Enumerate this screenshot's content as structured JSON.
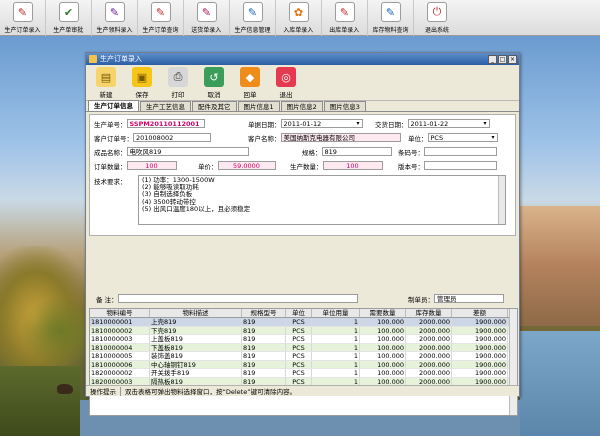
{
  "launcher": [
    {
      "label": "生产订单录入",
      "icon": "form-icon",
      "glyph": "✎",
      "color": "#c62828"
    },
    {
      "label": "生产单审批",
      "icon": "approve-icon",
      "glyph": "✔",
      "color": "#2e7d32"
    },
    {
      "label": "生产领料录入",
      "icon": "material-icon",
      "glyph": "✎",
      "color": "#6a1b9a"
    },
    {
      "label": "生产订单查询",
      "icon": "query-icon",
      "glyph": "✎",
      "color": "#c62828"
    },
    {
      "label": "送货单录入",
      "icon": "delivery-icon",
      "glyph": "✎",
      "color": "#ad1457"
    },
    {
      "label": "生产信息管理",
      "icon": "info-icon",
      "glyph": "✎",
      "color": "#1565c0"
    },
    {
      "label": "入库单录入",
      "icon": "stock-in-icon",
      "glyph": "✿",
      "color": "#ef6c00"
    },
    {
      "label": "出库单录入",
      "icon": "stock-out-icon",
      "glyph": "✎",
      "color": "#c62828"
    },
    {
      "label": "库存物料查询",
      "icon": "inventory-icon",
      "glyph": "✎",
      "color": "#1565c0"
    },
    {
      "label": "退出系统",
      "icon": "exit-icon",
      "glyph": "⏻",
      "color": "#c62828"
    }
  ],
  "window": {
    "title": "生产订单录入",
    "controls": [
      "_",
      "□",
      "×"
    ]
  },
  "toolbar": [
    {
      "label": "新建",
      "icon": "new-doc-icon",
      "glyph": "▤",
      "bg": "#f7d46b",
      "fg": "#7a5a00"
    },
    {
      "label": "保存",
      "icon": "save-icon",
      "glyph": "▣",
      "bg": "#f5c518",
      "fg": "#7a5a00"
    },
    {
      "label": "打印",
      "icon": "print-icon",
      "glyph": "⎙",
      "bg": "#d7d7d7",
      "fg": "#333"
    },
    {
      "label": "取消",
      "icon": "cancel-icon",
      "glyph": "↺",
      "bg": "#3a9d5a",
      "fg": "#fff"
    },
    {
      "label": "回单",
      "icon": "return-icon",
      "glyph": "◆",
      "bg": "#ef8c1a",
      "fg": "#fff"
    },
    {
      "label": "退出",
      "icon": "exit-icon",
      "glyph": "◎",
      "bg": "#e53950",
      "fg": "#fff"
    }
  ],
  "tabs": [
    "生产订单信息",
    "生产工艺信息",
    "配件及其它",
    "图片信息1",
    "图片信息2",
    "图片信息3"
  ],
  "form": {
    "order_no_label": "生产单号：",
    "order_no": "SSPM20110112001",
    "order_date_label": "单据日期：",
    "order_date": "2011-01-12",
    "delivery_date_label": "交货日期：",
    "delivery_date": "2011-01-22",
    "cust_order_label": "客户订单号：",
    "cust_order": "201008002",
    "customer_label": "客户名称：",
    "customer": "美国纳斯克电器有限公司",
    "unit_label": "单位：",
    "unit": "PCS",
    "product_label": "成品名称：",
    "product": "电吹风819",
    "spec_label": "规格：",
    "spec": "819",
    "barcode_label": "条码号：",
    "barcode": "",
    "qty_label": "订单数量：",
    "qty": "100",
    "price_label": "单价：",
    "price": "59.0000",
    "prod_qty_label": "生产数量：",
    "prod_qty": "100",
    "version_label": "版本号：",
    "version": "",
    "tech_label": "技术要求：",
    "tech_lines": [
      "(1) 功率：1300-1500W",
      "(2) 能够吸读取功耗",
      "(3) 自制选择负板",
      "(4) 3500转动带控",
      "(5) 出风口温度180以上，且必须稳定"
    ],
    "remark_label": "备  注：",
    "remark": "",
    "maker_label": "制单员：",
    "maker": "管理员"
  },
  "grid": {
    "headers": [
      "物料编号",
      "物料描述",
      "规格型号",
      "单位",
      "单位用量",
      "需要数量",
      "库存数量",
      "差额"
    ],
    "rows": [
      [
        "1810000001",
        "上壳819",
        "819",
        "PCS",
        "1",
        "100.000",
        "2000.000",
        "1900.000"
      ],
      [
        "1810000002",
        "下壳819",
        "819",
        "PCS",
        "1",
        "100.000",
        "2000.000",
        "1900.000"
      ],
      [
        "1810000003",
        "上盖板819",
        "819",
        "PCS",
        "1",
        "100.000",
        "2000.000",
        "1900.000"
      ],
      [
        "1810000004",
        "下盖板819",
        "819",
        "PCS",
        "1",
        "100.000",
        "2000.000",
        "1900.000"
      ],
      [
        "1810000005",
        "装饰盖819",
        "819",
        "PCS",
        "1",
        "100.000",
        "2000.000",
        "1900.000"
      ],
      [
        "1810000006",
        "中心轴铜钉819",
        "819",
        "PCS",
        "1",
        "100.000",
        "2000.000",
        "1900.000"
      ],
      [
        "1820000002",
        "开关拨手819",
        "819",
        "PCS",
        "1",
        "100.000",
        "2000.000",
        "1900.000"
      ],
      [
        "1820000003",
        "隔热板819",
        "819",
        "PCS",
        "1",
        "100.000",
        "2000.000",
        "1900.000"
      ]
    ]
  },
  "status": {
    "label": "操作提示",
    "text": "双击表格可弹出物料选择窗口，按“Delete”键可清除内容。"
  }
}
